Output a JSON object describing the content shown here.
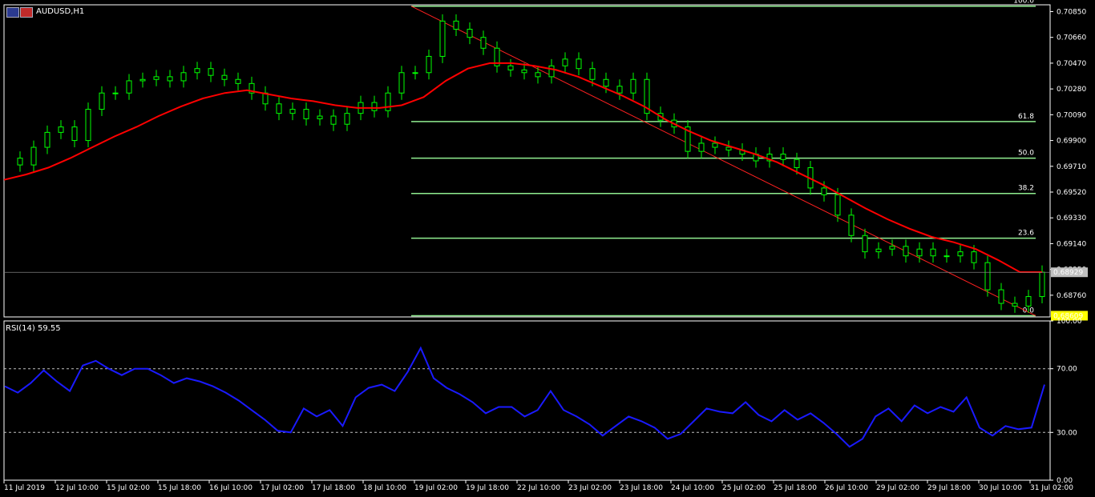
{
  "symbol_title": "AUDUSD,H1",
  "rsi_title": "RSI(14) 59.55",
  "colors": {
    "bull": "#00ff00",
    "bear": "#00ff00",
    "ma": "#ff0000",
    "fib": "#90ee90",
    "rsi": "#1a1aff",
    "axis": "#ffffff",
    "price_tag_current": "#c0c0c0",
    "price_tag_low": "#ffff00"
  },
  "price_axis": {
    "ticks": [
      "0.70850",
      "0.70660",
      "0.70470",
      "0.70280",
      "0.70090",
      "0.69900",
      "0.69710",
      "0.69520",
      "0.69330",
      "0.69140",
      "0.68950",
      "0.68760"
    ]
  },
  "current_price": "0.68929",
  "low_price": "0.68609",
  "fib_levels": [
    {
      "label": "100.0",
      "value": 0.7089
    },
    {
      "label": "61.8",
      "value": 0.7004
    },
    {
      "label": "50.0",
      "value": 0.6977
    },
    {
      "label": "38.2",
      "value": 0.6951
    },
    {
      "label": "23.6",
      "value": 0.6918
    },
    {
      "label": "0.0",
      "value": 0.68609
    }
  ],
  "rsi_axis": {
    "ticks": [
      "100.00",
      "70.00",
      "30.00",
      "0.00"
    ]
  },
  "time_axis": [
    "11 Jul 2019",
    "12 Jul 10:00",
    "15 Jul 02:00",
    "15 Jul 18:00",
    "16 Jul 10:00",
    "17 Jul 02:00",
    "17 Jul 18:00",
    "18 Jul 10:00",
    "19 Jul 02:00",
    "19 Jul 18:00",
    "22 Jul 10:00",
    "23 Jul 02:00",
    "23 Jul 18:00",
    "24 Jul 10:00",
    "25 Jul 02:00",
    "25 Jul 18:00",
    "26 Jul 10:00",
    "29 Jul 02:00",
    "29 Jul 18:00",
    "30 Jul 10:00",
    "31 Jul 02:00"
  ],
  "chart_data": {
    "type": "line",
    "title": "AUDUSD,H1",
    "price_ylim": [
      0.686,
      0.709
    ],
    "price_series": [
      {
        "name": "close",
        "values": [
          0.6977,
          0.6972,
          0.6985,
          0.6996,
          0.7,
          0.699,
          0.7013,
          0.7025,
          0.7025,
          0.7034,
          0.7035,
          0.7037,
          0.7034,
          0.704,
          0.7043,
          0.7038,
          0.7035,
          0.7032,
          0.7025,
          0.7017,
          0.701,
          0.7013,
          0.7006,
          0.7008,
          0.7002,
          0.701,
          0.7018,
          0.7012,
          0.7025,
          0.704,
          0.704,
          0.7052,
          0.7078,
          0.7072,
          0.7066,
          0.7058,
          0.7045,
          0.7042,
          0.704,
          0.7037,
          0.7045,
          0.705,
          0.7043,
          0.7035,
          0.703,
          0.7025,
          0.7035,
          0.701,
          0.7005,
          0.7,
          0.6982,
          0.6988,
          0.6985,
          0.6983,
          0.698,
          0.6975,
          0.698,
          0.6976,
          0.697,
          0.6955,
          0.695,
          0.6935,
          0.692,
          0.6908,
          0.691,
          0.6912,
          0.6905,
          0.691,
          0.6905,
          0.6905,
          0.6908,
          0.69,
          0.688,
          0.687,
          0.6868,
          0.6875,
          0.6893
        ]
      },
      {
        "name": "ma",
        "values": [
          0.6961,
          0.6965,
          0.697,
          0.6977,
          0.6985,
          0.6993,
          0.7,
          0.7008,
          0.7015,
          0.7021,
          0.7025,
          0.7027,
          0.7024,
          0.7021,
          0.7019,
          0.7016,
          0.7014,
          0.7014,
          0.7016,
          0.7022,
          0.7034,
          0.7043,
          0.7047,
          0.7047,
          0.7045,
          0.7042,
          0.7037,
          0.703,
          0.7023,
          0.7015,
          0.7005,
          0.6997,
          0.699,
          0.6985,
          0.698,
          0.6974,
          0.6966,
          0.6958,
          0.6949,
          0.694,
          0.6932,
          0.6925,
          0.6919,
          0.6915,
          0.691,
          0.6902,
          0.6893,
          0.6893
        ]
      }
    ],
    "rsi_ylim": [
      0,
      100
    ],
    "rsi_levels": [
      70,
      30
    ],
    "rsi_series": {
      "name": "RSI(14)",
      "values": [
        59,
        55,
        61,
        69,
        62,
        56,
        72,
        75,
        70,
        66,
        70,
        70,
        66,
        61,
        64,
        62,
        59,
        55,
        50,
        44,
        38,
        31,
        30,
        45,
        40,
        44,
        34,
        52,
        58,
        60,
        56,
        68,
        83,
        64,
        58,
        54,
        49,
        42,
        46,
        46,
        40,
        44,
        56,
        44,
        40,
        35,
        28,
        34,
        40,
        37,
        33,
        26,
        29,
        37,
        45,
        43,
        42,
        49,
        41,
        37,
        44,
        38,
        42,
        36,
        29,
        21,
        26,
        40,
        45,
        37,
        47,
        42,
        46,
        43,
        52,
        33,
        28,
        34,
        32,
        33,
        60
      ]
    }
  }
}
